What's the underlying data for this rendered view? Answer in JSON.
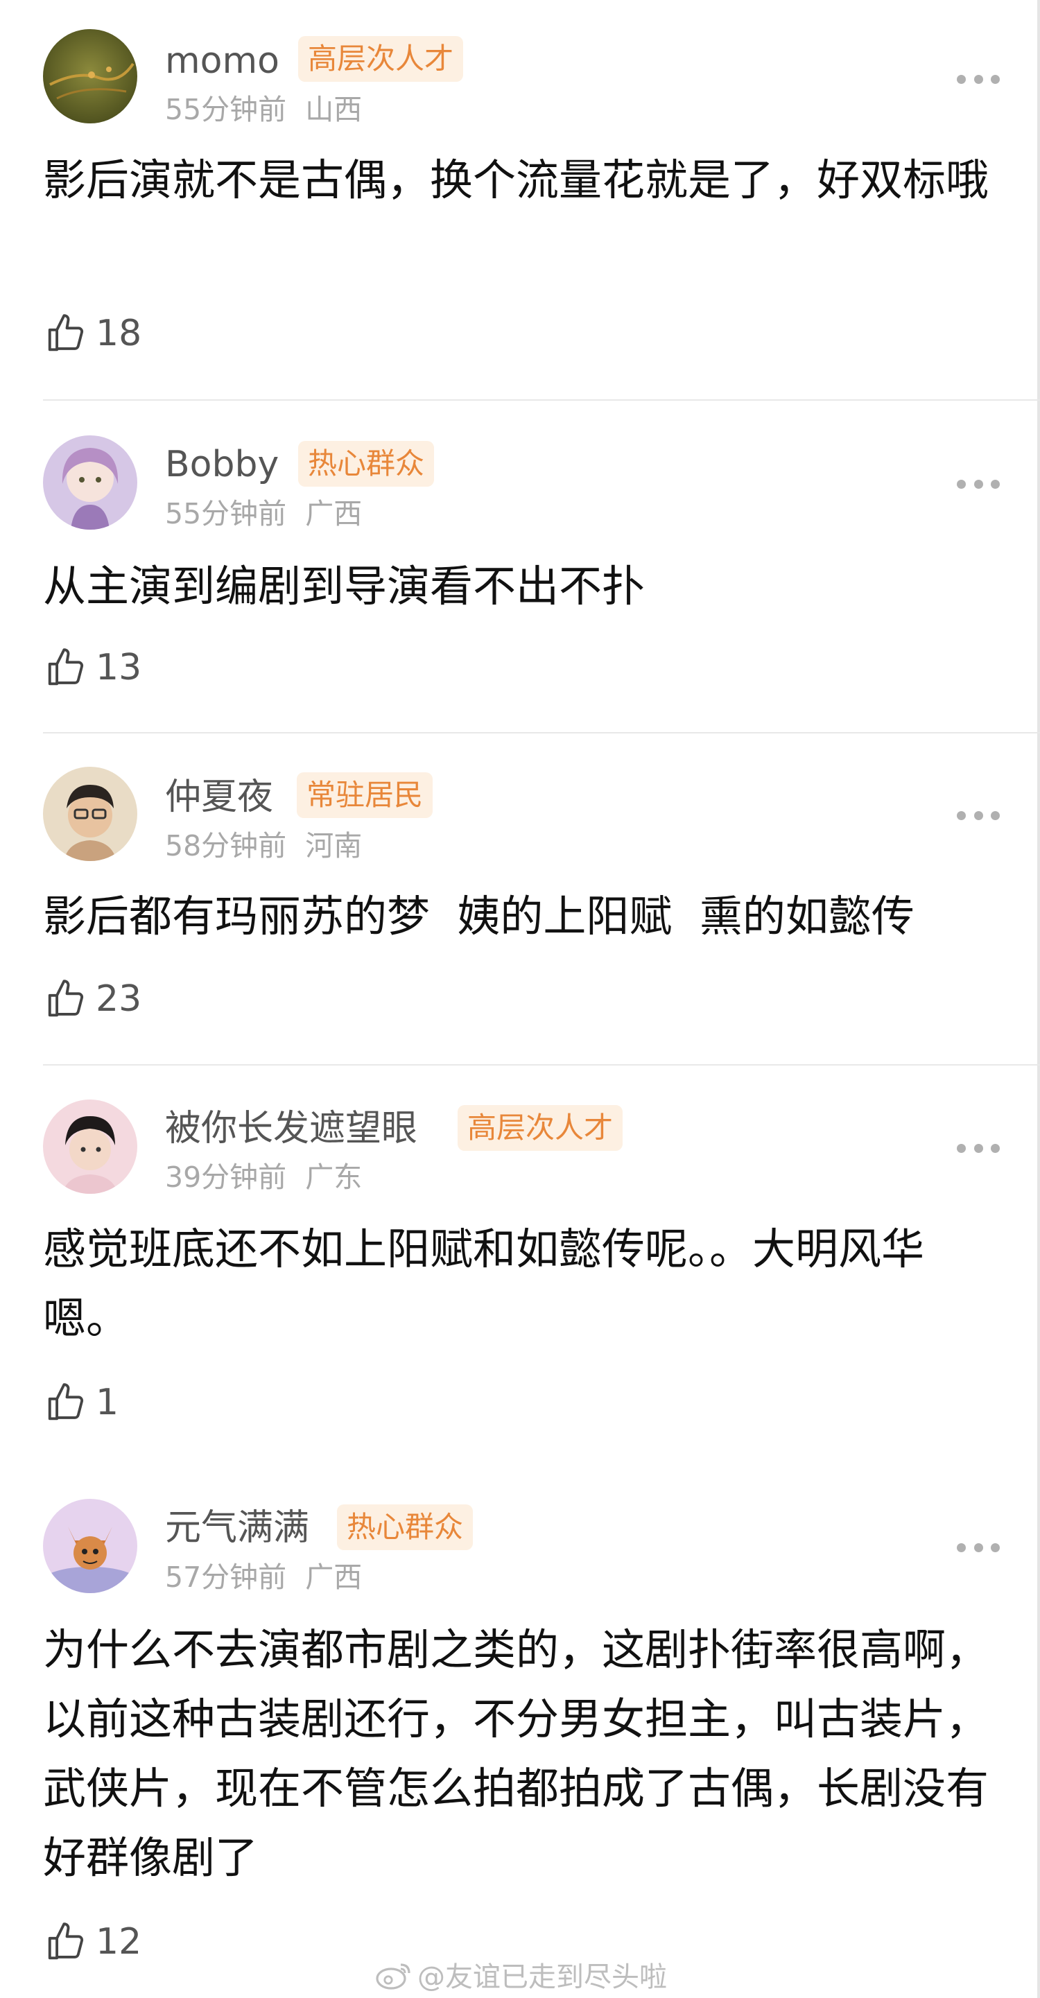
{
  "comments": [
    {
      "username": "momo",
      "badge": "高层次人才",
      "time": "55分钟前",
      "location": "山西",
      "text": "影后演就不是古偶，换个流量花就是了，好双标哦",
      "likes": "18"
    },
    {
      "username": "Bobby",
      "badge": "热心群众",
      "time": "55分钟前",
      "location": "广西",
      "text": "从主演到编剧到导演看不出不扑",
      "likes": "13"
    },
    {
      "username": "仲夏夜",
      "badge": "常驻居民",
      "time": "58分钟前",
      "location": "河南",
      "text": "影后都有玛丽苏的梦  姨的上阳赋  熏的如懿传",
      "likes": "23"
    },
    {
      "username": "被你长发遮望眼",
      "badge": "高层次人才",
      "time": "39分钟前",
      "location": "广东",
      "text": "感觉班底还不如上阳赋和如懿传呢。。大明风华嗯。",
      "likes": "1"
    },
    {
      "username": "元气满满",
      "badge": "热心群众",
      "time": "57分钟前",
      "location": "广西",
      "text": "为什么不去演都市剧之类的，这剧扑街率很高啊，以前这种古装剧还行，不分男女担主，叫古装片，武侠片，现在不管怎么拍都拍成了古偶，长剧没有好群像剧了",
      "likes": "12"
    }
  ],
  "watermark": "@友谊已走到尽头啦",
  "colors": {
    "badge_text": "#e8873a",
    "badge_bg": "#fdf0e2",
    "meta": "#a8a8a8",
    "username": "#555555"
  },
  "icons": [
    "more-options-icon",
    "thumbs-up-icon",
    "weibo-logo-icon"
  ]
}
